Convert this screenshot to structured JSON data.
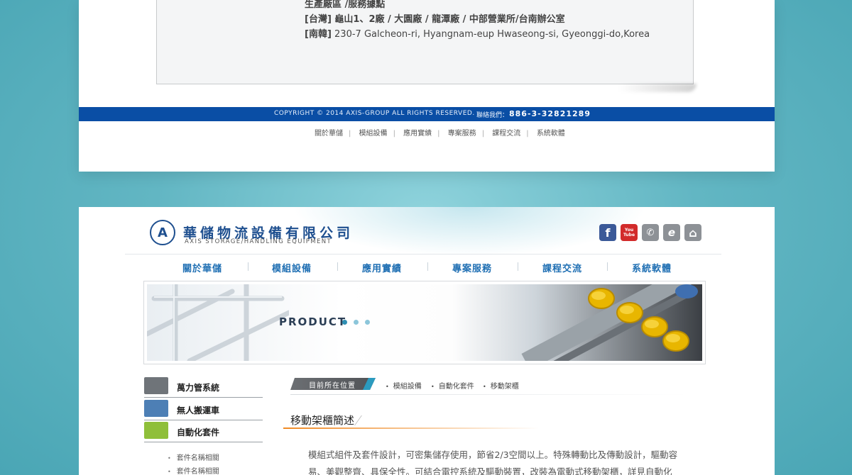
{
  "top_section": {
    "address_heading": "生產廠區 /服務據點",
    "address_taiwan": "[台灣] 龜山1、2廠 / 大園廠 / 龍潭廠 / 中部營業所/台南辦公室",
    "address_korea_label": "[南韓]",
    "address_korea": "230-7 Galcheon-ri, Hyangnam-eup Hwaseong-si, Gyeonggi-do,Korea",
    "copyright": "COPYRIGHT © 2014 AXIS-GROUP ALL RIGHTS RESERVED.",
    "contact_label": "聯絡我們：",
    "contact_phone": "886-3-32821289",
    "footer_links": [
      "關於華儲",
      "模組設備",
      "應用實績",
      "專案服務",
      "課程交流",
      "系統軟體"
    ]
  },
  "header": {
    "logo_letter": "A",
    "brand_zh": "華儲物流設備有限公司",
    "brand_en": "AXIS STORAGE/HANDLING EQUIPMENT",
    "social": [
      {
        "icon": "facebook-icon",
        "glyph": "f",
        "color": "#3b5998"
      },
      {
        "icon": "youtube-icon",
        "glyph": "You Tube",
        "color": "#d22b2b"
      },
      {
        "icon": "phone-icon",
        "glyph": "✆",
        "color": "#8d9196"
      },
      {
        "icon": "epaper-icon",
        "glyph": "e",
        "color": "#8d9196"
      },
      {
        "icon": "home-icon",
        "glyph": "⌂",
        "color": "#8d9196"
      }
    ]
  },
  "nav": [
    "關於華儲",
    "模組設備",
    "應用實績",
    "專案服務",
    "課程交流",
    "系統軟體"
  ],
  "banner": {
    "product_word": "PRODUCT",
    "dot_colors": [
      "#2e8fb3",
      "#8cc6da",
      "#8cc6da"
    ]
  },
  "sidebar": {
    "items": [
      {
        "label": "萬力管系統",
        "thumb_color": "#6f7479"
      },
      {
        "label": "無人搬運車",
        "thumb_color": "#4d7fb5"
      },
      {
        "label": "自動化套件",
        "thumb_color": "#8fbf3a"
      }
    ],
    "sub_items": [
      "套件名稱相關",
      "套件名稱相關"
    ]
  },
  "content": {
    "location_tag": "目前所在位置",
    "breadcrumb": [
      "模組設備",
      "自動化套件",
      "移動架櫃"
    ],
    "section_title": "移動架櫃簡述",
    "body": "模組式組件及套件設計，可密集儲存使用，節省2/3空間以上。特殊轉動比及傳動設計，驅動容易、美觀整齊、具保全性。可結合電控系統及驅動裝置，改裝為電動式移動架櫃，詳見自動化"
  },
  "colors": {
    "brand_blue": "#1e4f8f",
    "nav_blue": "#1f6fb3",
    "footer_bar": "#0a4ea5",
    "accent_orange": "#f08a24",
    "background_teal": "#5fb4c1"
  }
}
